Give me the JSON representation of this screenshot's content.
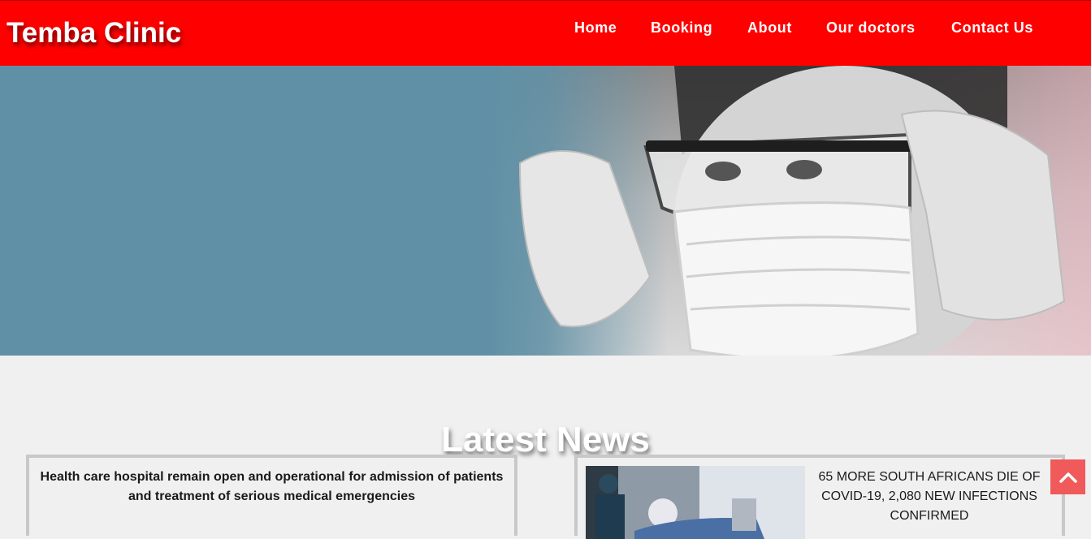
{
  "header": {
    "brand": "Temba Clinic",
    "nav": [
      {
        "label": "Home"
      },
      {
        "label": "Booking"
      },
      {
        "label": "About"
      },
      {
        "label": "Our doctors"
      },
      {
        "label": "Contact Us"
      }
    ],
    "color": "#ff0000"
  },
  "hero": {
    "background_color": "#6090a5",
    "image_icon": "masked-health-worker-photo"
  },
  "news": {
    "title": "Latest News",
    "items": [
      {
        "headline": "Health care hospital remain open and operational for admission of patients and treatment of serious medical emergencies"
      },
      {
        "headline": "65 MORE SOUTH AFRICANS DIE OF COVID-19, 2,080 NEW INFECTIONS CONFIRMED",
        "image_icon": "hospital-ward-photo"
      }
    ]
  },
  "scroll_top": {
    "icon": "chevron-up-icon",
    "color": "#f05a5a"
  }
}
